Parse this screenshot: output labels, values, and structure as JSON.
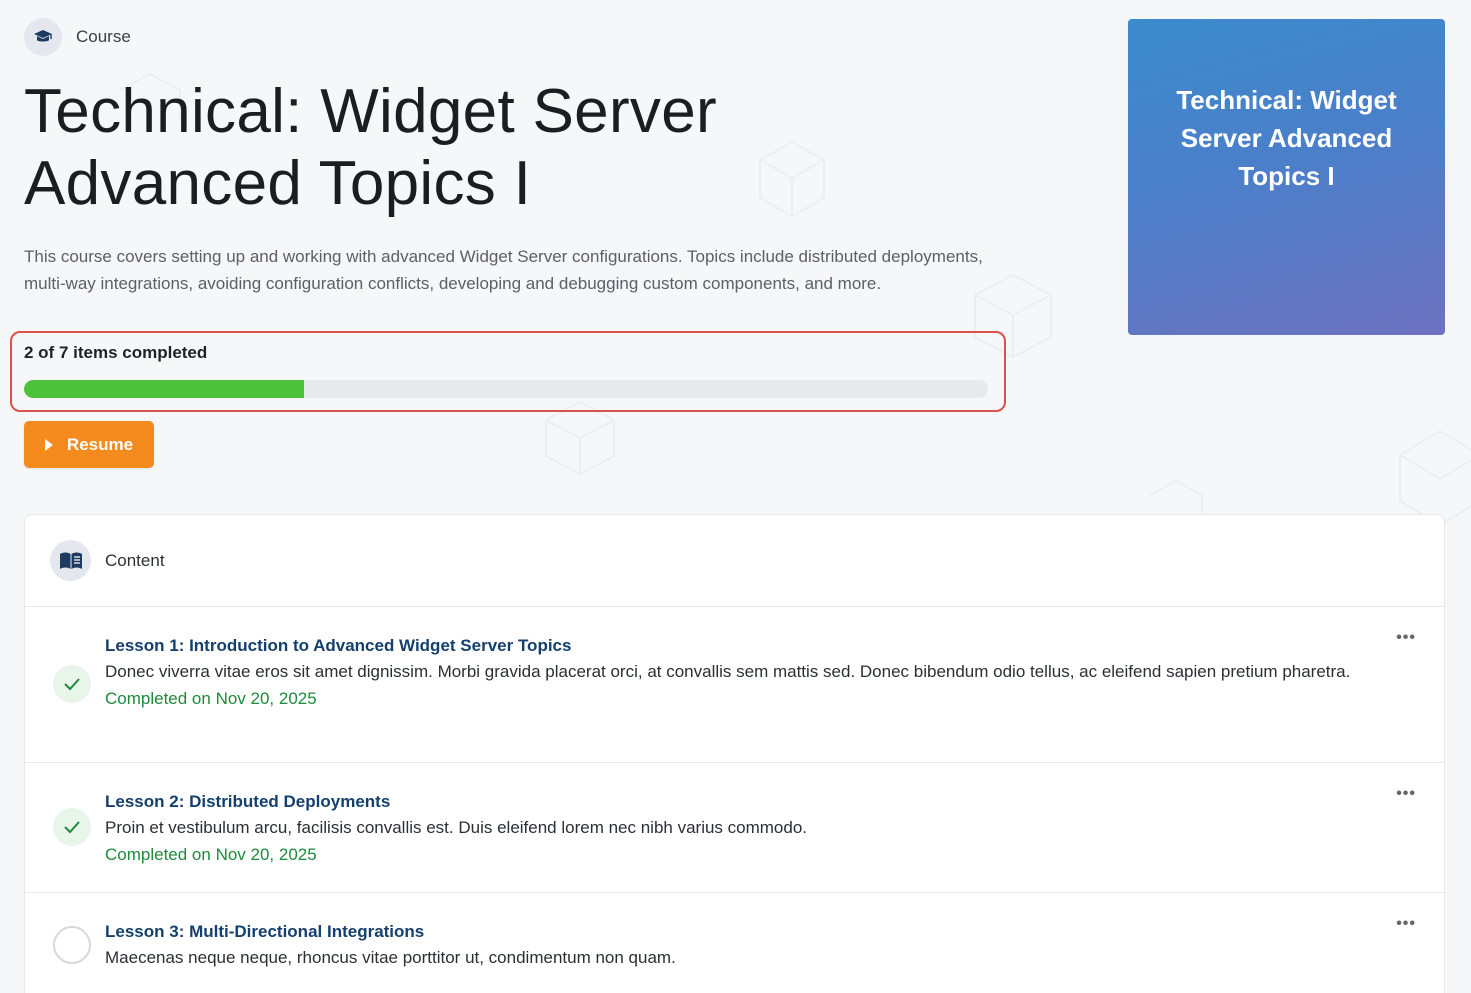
{
  "header": {
    "tag_label": "Course",
    "title": "Technical: Widget Server Advanced Topics I",
    "description": "This course covers setting up and working with advanced Widget Server configurations. Topics include distributed deployments, multi-way integrations, avoiding configuration conflicts, developing and debugging custom components, and more."
  },
  "progress": {
    "label": "2 of 7 items completed",
    "completed": 2,
    "total": 7,
    "fill_fraction": 0.29,
    "color": "#4dc13b"
  },
  "resume_button": {
    "label": "Resume"
  },
  "thumbnail": {
    "title": "Technical: Widget Server Advanced Topics I"
  },
  "content": {
    "heading": "Content",
    "lessons": [
      {
        "title": "Lesson 1: Introduction to Advanced Widget Server Topics",
        "description": "Donec viverra vitae eros sit amet dignissim. Morbi gravida placerat orci, at convallis sem mattis sed. Donec bibendum odio tellus, ac eleifend sapien pretium pharetra.",
        "completed": true,
        "completed_text": "Completed on Nov 20, 2025"
      },
      {
        "title": "Lesson 2: Distributed Deployments",
        "description": "Proin et vestibulum arcu, facilisis convallis est. Duis eleifend lorem nec nibh varius commodo.",
        "completed": true,
        "completed_text": "Completed on Nov 20, 2025"
      },
      {
        "title": "Lesson 3: Multi-Directional Integrations",
        "description": "Maecenas neque neque, rhoncus vitae porttitor ut, condimentum non quam.",
        "completed": false,
        "completed_text": ""
      }
    ],
    "more_label": "•••"
  },
  "colors": {
    "accent_orange": "#f58a1f",
    "lesson_title": "#15406d",
    "completed_green": "#1f8a3a",
    "highlight_border": "#d9534a"
  }
}
